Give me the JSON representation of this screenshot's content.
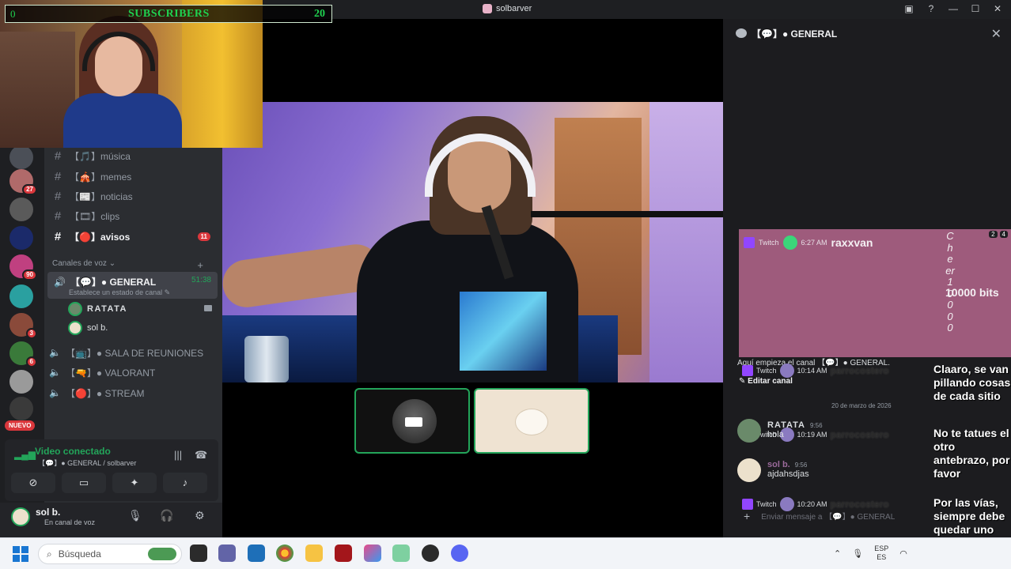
{
  "window": {
    "title": "solbarver"
  },
  "overlay": {
    "subscriber_label": "SUBSCRIBERS",
    "subscriber_left": "0",
    "subscriber_count": "20"
  },
  "servers": {
    "badges": [
      "27",
      "90",
      "3",
      "6"
    ],
    "new_label": "NUEVO"
  },
  "channels": {
    "text": [
      {
        "name": "【🎵】música"
      },
      {
        "name": "【🎪】memes"
      },
      {
        "name": "【📰】noticias"
      },
      {
        "name": "【🎞】clips"
      },
      {
        "name": "【🔴】avisos",
        "unread": "11"
      }
    ],
    "voice_category": "Canales de voz",
    "voice_active": {
      "name": "【💬】● GENERAL",
      "time": "51:38",
      "status": "Establece un estado de canal"
    },
    "voice_users": [
      {
        "name": "RATATA"
      },
      {
        "name": "sol b."
      }
    ],
    "voice_other": [
      {
        "name": "【📺】● SALA DE REUNIONES"
      },
      {
        "name": "【🔫】● VALORANT"
      },
      {
        "name": "【🔴】● STREAM"
      }
    ]
  },
  "voice_panel": {
    "status": "Video conectado",
    "sub": "【💬】● GENERAL / solbarver"
  },
  "user": {
    "name": "sol b.",
    "status": "En canal de voz"
  },
  "chat": {
    "header": "【💬】● GENERAL",
    "cheer": {
      "source": "Twitch",
      "time": "6:27 AM",
      "user": "raxxvan",
      "word": "Cheer10000",
      "bits": "10000 bits",
      "badge1": "2",
      "badge2": "4"
    },
    "system_line": "Aquí empieza el canal 【💬】● GENERAL.",
    "edit_channel": "Editar canal",
    "date_divider": "20 de marzo de 2026",
    "tw_messages": [
      {
        "source": "Twitch",
        "time": "10:14 AM",
        "user": "parrocostero",
        "text": "Claaro, se van pillando cosas de cada sitio"
      },
      {
        "source": "Twitch",
        "time": "10:19 AM",
        "user": "parrocostero",
        "text": "No te tatues el otro antebrazo, por favor"
      },
      {
        "source": "Twitch",
        "time": "10:20 AM",
        "user": "parrocostero",
        "text": "Por las vías, siempre debe quedar uno despejado, sin tintar"
      }
    ],
    "discord_messages": [
      {
        "user": "RATATA",
        "time": "9:56",
        "text": "hola"
      },
      {
        "user": "sol b.",
        "time": "9:56",
        "text": "ajdahsdjas"
      }
    ],
    "composer_placeholder": "Enviar mensaje a 【💬】● GENERAL"
  },
  "taskbar": {
    "search_placeholder": "Búsqueda",
    "lang_top": "ESP",
    "lang_bottom": "ES"
  }
}
